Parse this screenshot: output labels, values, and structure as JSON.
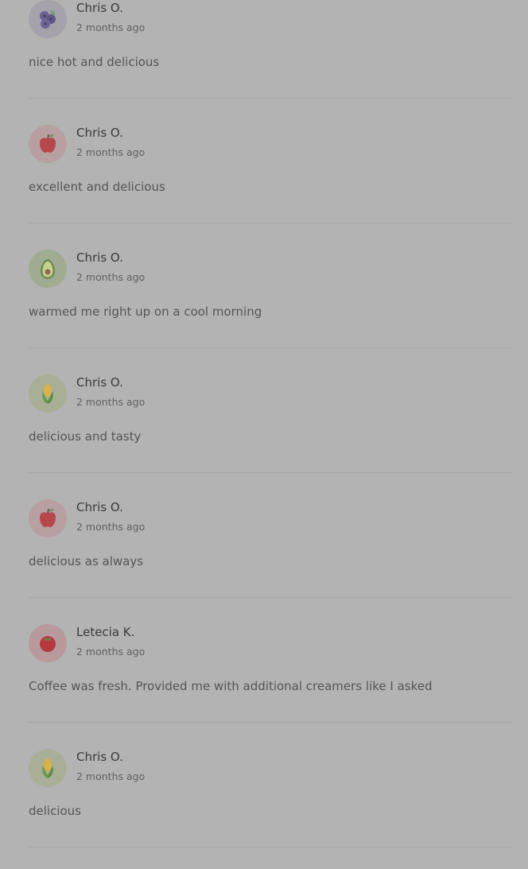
{
  "colors": {
    "overlay_background": "#b3b3b3",
    "name_text": "#3a3a3a",
    "time_text": "#616161",
    "body_text": "#555555",
    "divider": "#a6a6a6"
  },
  "reviews": [
    {
      "name": "Chris O.",
      "time": "2 months ago",
      "body": "nice hot and delicious",
      "avatar_icon": "blueberry-icon",
      "avatar_bg": "#a5a2ab"
    },
    {
      "name": "Chris O.",
      "time": "2 months ago",
      "body": "excellent and delicious",
      "avatar_icon": "apple-icon",
      "avatar_bg": "#b89fa2"
    },
    {
      "name": "Chris O.",
      "time": "2 months ago",
      "body": "warmed me right up on a cool morning",
      "avatar_icon": "avocado-icon",
      "avatar_bg": "#9fac92"
    },
    {
      "name": "Chris O.",
      "time": "2 months ago",
      "body": "delicious and tasty",
      "avatar_icon": "corn-icon",
      "avatar_bg": "#a9af96"
    },
    {
      "name": "Chris O.",
      "time": "2 months ago",
      "body": "delicious as always",
      "avatar_icon": "apple-icon",
      "avatar_bg": "#b89fa2"
    },
    {
      "name": "Letecia K.",
      "time": "2 months ago",
      "body": "Coffee was fresh. Provided me with additional creamers like I asked",
      "avatar_icon": "tomato-icon",
      "avatar_bg": "#b99a9c"
    },
    {
      "name": "Chris O.",
      "time": "2 months ago",
      "body": "delicious",
      "avatar_icon": "corn-icon",
      "avatar_bg": "#a9af96"
    }
  ]
}
